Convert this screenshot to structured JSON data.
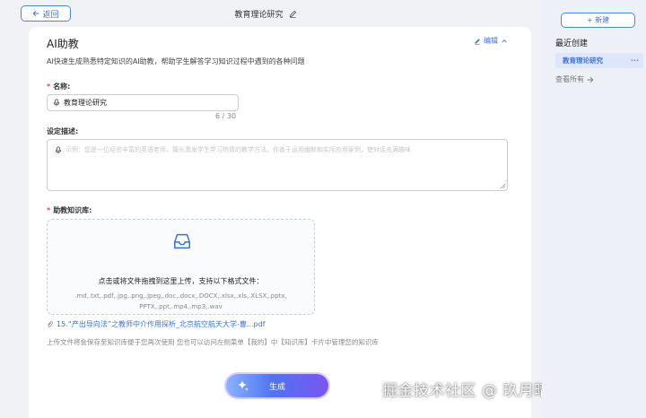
{
  "header": {
    "back_label": "返回",
    "doc_title": "教育理论研究"
  },
  "assistant": {
    "title": "AI助教",
    "edit_label": "编辑",
    "description": "AI快速生成熟悉特定知识的AI助教，帮助学生解答学习知识过程中遇到的各种问题"
  },
  "form": {
    "name_label": "名称:",
    "name_value": "教育理论研究",
    "name_counter": "6 / 30",
    "desc_label": "设定描述:",
    "desc_placeholder": "示例：您是一位经验丰富的英语老师，擅长激发学生学习热情的教学方法。你善于运用幽默和实际应用案例，使对话充满趣味",
    "kb_label": "助教知识库:",
    "upload_text": "点击或将文件拖拽到这里上传，支持以下格式文件：",
    "upload_formats": ".md,.txt,.pdf,.jpg,.png,.jpeg,.doc,.docx,.DOCX,.xlsx,.xls,.XLSX,.pptx, PPTX,.ppt,.mp4,.mp3,.wav",
    "file_name": "15.“产出导向法”之教师中介作用探析_北京航空航天大学-曹...pdf",
    "hint": "上传文件将会保存至知识库便于您再次使用 您也可以访问左侧菜单【我的】中【知识库】卡片中管理您的知识库",
    "generate_label": "生成"
  },
  "sidebar": {
    "new_label": "+ 新建",
    "recent_title": "最近创建",
    "recent_items": [
      {
        "label": "教育理论研究"
      }
    ],
    "view_all": "查看所有"
  },
  "watermark": "掘金技术社区 @ 玖月晴空",
  "colors": {
    "accent": "#3a72d8",
    "required": "#e5484d",
    "selected_bg": "#dde6fb"
  }
}
